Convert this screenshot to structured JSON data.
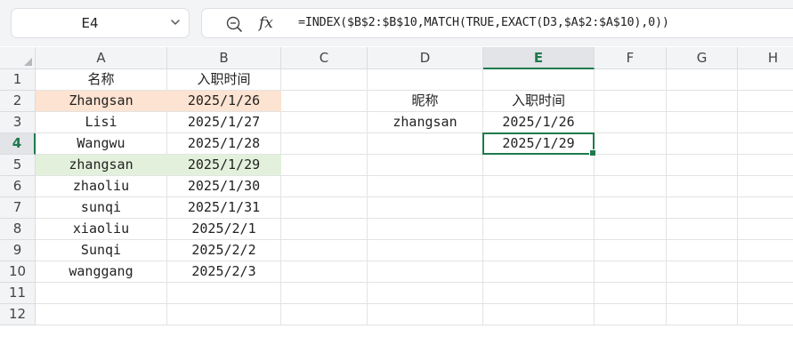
{
  "name_box": {
    "value": "E4"
  },
  "formula_bar": {
    "fx_label": "fx",
    "formula": "=INDEX($B$2:$B$10,MATCH(TRUE,EXACT(D3,$A$2:$A$10),0))"
  },
  "columns": [
    "A",
    "B",
    "C",
    "D",
    "E",
    "F",
    "G",
    "H"
  ],
  "rows": [
    "1",
    "2",
    "3",
    "4",
    "5",
    "6",
    "7",
    "8",
    "9",
    "10",
    "11",
    "12"
  ],
  "selected": {
    "col": "E",
    "row": "4"
  },
  "colors": {
    "highlight_orange": "#fde3d1",
    "highlight_green": "#e3f1dc",
    "selection_green": "#1f7a4d"
  },
  "cells": [
    {
      "ref": "A1",
      "value": "名称"
    },
    {
      "ref": "B1",
      "value": "入职时间"
    },
    {
      "ref": "A2",
      "value": "Zhangsan",
      "fill": "#fde3d1"
    },
    {
      "ref": "B2",
      "value": "2025/1/26",
      "fill": "#fde3d1"
    },
    {
      "ref": "A3",
      "value": "Lisi"
    },
    {
      "ref": "B3",
      "value": "2025/1/27"
    },
    {
      "ref": "A4",
      "value": "Wangwu"
    },
    {
      "ref": "B4",
      "value": "2025/1/28"
    },
    {
      "ref": "A5",
      "value": "zhangsan",
      "fill": "#e3f1dc"
    },
    {
      "ref": "B5",
      "value": "2025/1/29",
      "fill": "#e3f1dc"
    },
    {
      "ref": "A6",
      "value": "zhaoliu"
    },
    {
      "ref": "B6",
      "value": "2025/1/30"
    },
    {
      "ref": "A7",
      "value": "sunqi"
    },
    {
      "ref": "B7",
      "value": "2025/1/31"
    },
    {
      "ref": "A8",
      "value": "xiaoliu"
    },
    {
      "ref": "B8",
      "value": "2025/2/1"
    },
    {
      "ref": "A9",
      "value": "Sunqi"
    },
    {
      "ref": "B9",
      "value": "2025/2/2"
    },
    {
      "ref": "A10",
      "value": "wanggang"
    },
    {
      "ref": "B10",
      "value": "2025/2/3"
    },
    {
      "ref": "D2",
      "value": "昵称"
    },
    {
      "ref": "E2",
      "value": "入职时间"
    },
    {
      "ref": "D3",
      "value": "zhangsan"
    },
    {
      "ref": "E3",
      "value": "2025/1/26"
    },
    {
      "ref": "E4",
      "value": "2025/1/29"
    }
  ]
}
